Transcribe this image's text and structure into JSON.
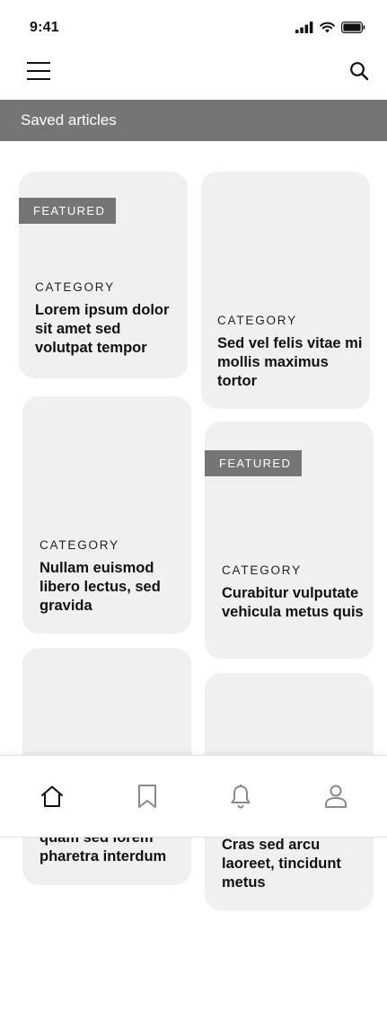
{
  "status_bar": {
    "time": "9:41"
  },
  "header": {
    "menu_icon": "hamburger-icon",
    "search_icon": "search-icon"
  },
  "section": {
    "title": "Saved articles"
  },
  "articles": [
    {
      "featured": true,
      "badge": "FEATURED",
      "category": "CATEGORY",
      "title": "Lorem ipsum dolor sit amet sed volutpat tempor"
    },
    {
      "featured": false,
      "category": "CATEGORY",
      "title": "Sed vel felis vitae mi mollis maximus tortor"
    },
    {
      "featured": false,
      "category": "CATEGORY",
      "title": "Nullam euismod libero lectus, sed gravida"
    },
    {
      "featured": true,
      "badge": "FEATURED",
      "category": "CATEGORY",
      "title": "Curabitur vulputate vehicula metus quis"
    },
    {
      "featured": false,
      "title": "quam sed lorem pharetra interdum"
    },
    {
      "featured": false,
      "title": "Cras sed arcu laoreet, tincidunt metus"
    }
  ],
  "tab_bar": {
    "active": "home",
    "tabs": [
      {
        "id": "home",
        "icon": "home-icon"
      },
      {
        "id": "saved",
        "icon": "bookmark-icon"
      },
      {
        "id": "notifications",
        "icon": "bell-icon"
      },
      {
        "id": "profile",
        "icon": "user-icon"
      }
    ]
  },
  "colors": {
    "header_bar": "#757575",
    "card_bg": "#f0f0f0",
    "badge_bg": "#757575",
    "active_icon": "#111111",
    "inactive_icon": "#8a8a8a"
  }
}
